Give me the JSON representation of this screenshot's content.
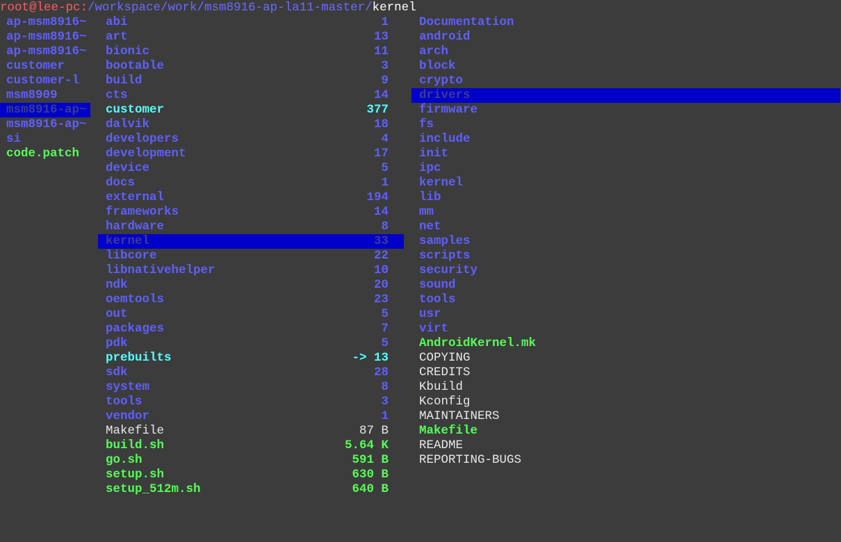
{
  "prompt": {
    "user_host": "root@lee-pc:",
    "path": "/workspace/work/msm8916-ap-la11-master/",
    "current": "kernel"
  },
  "colors": {
    "background": "#3c3c3c",
    "directory": "#5f5fff",
    "symlink": "#55ffff",
    "executable": "#55ff55",
    "regular_file": "#e8e8e8",
    "selection": "#0000c8",
    "prompt_user": "#ff5c5c"
  },
  "left_pane": [
    {
      "name": "ap-msm8916~",
      "type": "dir"
    },
    {
      "name": "ap-msm8916~",
      "type": "dir"
    },
    {
      "name": "ap-msm8916~",
      "type": "dir"
    },
    {
      "name": "customer",
      "type": "dir"
    },
    {
      "name": "customer-l",
      "type": "dir"
    },
    {
      "name": "msm8909",
      "type": "dir"
    },
    {
      "name": "msm8916-ap~",
      "type": "dir",
      "selected": true
    },
    {
      "name": "msm8916-ap~",
      "type": "dir"
    },
    {
      "name": "si",
      "type": "dir"
    },
    {
      "name": "code.patch",
      "type": "exec"
    }
  ],
  "middle_pane": [
    {
      "name": "abi",
      "meta": "1",
      "type": "dir"
    },
    {
      "name": "art",
      "meta": "13",
      "type": "dir"
    },
    {
      "name": "bionic",
      "meta": "11",
      "type": "dir"
    },
    {
      "name": "bootable",
      "meta": "3",
      "type": "dir"
    },
    {
      "name": "build",
      "meta": "9",
      "type": "dir"
    },
    {
      "name": "cts",
      "meta": "14",
      "type": "dir"
    },
    {
      "name": "customer",
      "meta": "377",
      "type": "link"
    },
    {
      "name": "dalvik",
      "meta": "18",
      "type": "dir"
    },
    {
      "name": "developers",
      "meta": "4",
      "type": "dir"
    },
    {
      "name": "development",
      "meta": "17",
      "type": "dir"
    },
    {
      "name": "device",
      "meta": "5",
      "type": "dir"
    },
    {
      "name": "docs",
      "meta": "1",
      "type": "dir"
    },
    {
      "name": "external",
      "meta": "194",
      "type": "dir"
    },
    {
      "name": "frameworks",
      "meta": "14",
      "type": "dir"
    },
    {
      "name": "hardware",
      "meta": "8",
      "type": "dir"
    },
    {
      "name": "kernel",
      "meta": "33",
      "type": "dir",
      "selected": true
    },
    {
      "name": "libcore",
      "meta": "22",
      "type": "dir"
    },
    {
      "name": "libnativehelper",
      "meta": "10",
      "type": "dir"
    },
    {
      "name": "ndk",
      "meta": "20",
      "type": "dir"
    },
    {
      "name": "oemtools",
      "meta": "23",
      "type": "dir"
    },
    {
      "name": "out",
      "meta": "5",
      "type": "dir"
    },
    {
      "name": "packages",
      "meta": "7",
      "type": "dir"
    },
    {
      "name": "pdk",
      "meta": "5",
      "type": "dir"
    },
    {
      "name": "prebuilts",
      "meta": "-> 13",
      "type": "link"
    },
    {
      "name": "sdk",
      "meta": "28",
      "type": "dir"
    },
    {
      "name": "system",
      "meta": "8",
      "type": "dir"
    },
    {
      "name": "tools",
      "meta": "3",
      "type": "dir"
    },
    {
      "name": "vendor",
      "meta": "1",
      "type": "dir"
    },
    {
      "name": "Makefile",
      "meta": "87 B",
      "type": "file"
    },
    {
      "name": "build.sh",
      "meta": "5.64 K",
      "type": "exec"
    },
    {
      "name": "go.sh",
      "meta": "591 B",
      "type": "exec"
    },
    {
      "name": "setup.sh",
      "meta": "630 B",
      "type": "exec"
    },
    {
      "name": "setup_512m.sh",
      "meta": "640 B",
      "type": "exec"
    }
  ],
  "right_pane": [
    {
      "name": "Documentation",
      "type": "dir"
    },
    {
      "name": "android",
      "type": "dir"
    },
    {
      "name": "arch",
      "type": "dir"
    },
    {
      "name": "block",
      "type": "dir"
    },
    {
      "name": "crypto",
      "type": "dir"
    },
    {
      "name": "drivers",
      "type": "dir",
      "selected": true
    },
    {
      "name": "firmware",
      "type": "dir"
    },
    {
      "name": "fs",
      "type": "dir"
    },
    {
      "name": "include",
      "type": "dir"
    },
    {
      "name": "init",
      "type": "dir"
    },
    {
      "name": "ipc",
      "type": "dir"
    },
    {
      "name": "kernel",
      "type": "dir"
    },
    {
      "name": "lib",
      "type": "dir"
    },
    {
      "name": "mm",
      "type": "dir"
    },
    {
      "name": "net",
      "type": "dir"
    },
    {
      "name": "samples",
      "type": "dir"
    },
    {
      "name": "scripts",
      "type": "dir"
    },
    {
      "name": "security",
      "type": "dir"
    },
    {
      "name": "sound",
      "type": "dir"
    },
    {
      "name": "tools",
      "type": "dir"
    },
    {
      "name": "usr",
      "type": "dir"
    },
    {
      "name": "virt",
      "type": "dir"
    },
    {
      "name": "AndroidKernel.mk",
      "type": "exec"
    },
    {
      "name": "COPYING",
      "type": "file"
    },
    {
      "name": "CREDITS",
      "type": "file"
    },
    {
      "name": "Kbuild",
      "type": "file"
    },
    {
      "name": "Kconfig",
      "type": "file"
    },
    {
      "name": "MAINTAINERS",
      "type": "file"
    },
    {
      "name": "Makefile",
      "type": "exec"
    },
    {
      "name": "README",
      "type": "file"
    },
    {
      "name": "REPORTING-BUGS",
      "type": "file"
    }
  ]
}
